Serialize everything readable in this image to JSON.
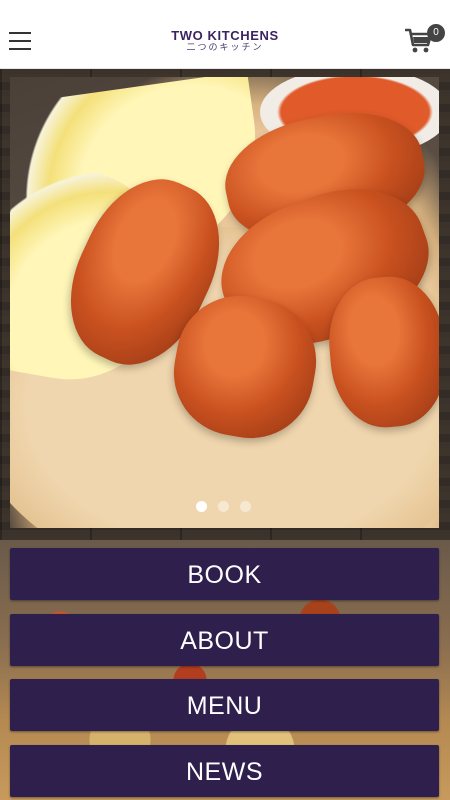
{
  "header": {
    "logo_main": "TWO KITCHENS",
    "logo_sub": "二つのキッチン",
    "cart_count": "0"
  },
  "slider": {
    "slide_count": 3,
    "active_index": 0
  },
  "nav": {
    "book": "BOOK",
    "about": "ABOUT",
    "menu": "MENU",
    "news": "NEWS"
  },
  "colors": {
    "brand": "#3b2462",
    "button_bg": "#2e1f4d",
    "button_text": "#ffffff"
  },
  "icons": {
    "menu": "hamburger-icon",
    "cart": "shopping-cart-icon"
  }
}
